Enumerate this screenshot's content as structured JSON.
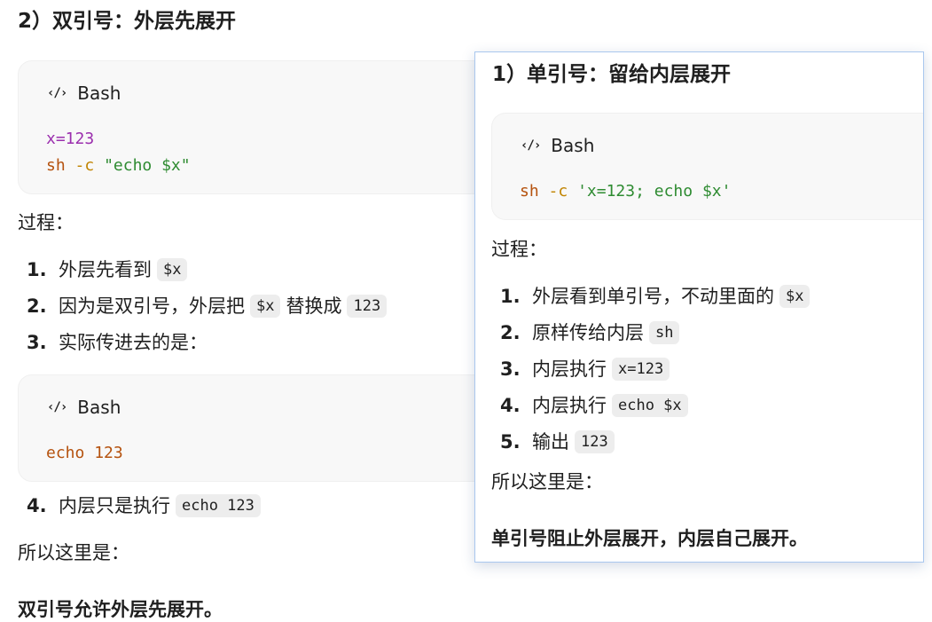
{
  "left": {
    "heading": "2）双引号：外层先展开",
    "code1": {
      "lang": "Bash",
      "line1": {
        "var": "x=123"
      },
      "line2": {
        "cmd": "sh",
        "flag": "-c",
        "str": "\"echo $x\""
      }
    },
    "process_label": "过程：",
    "steps_a": [
      {
        "num": "1.",
        "text": "外层先看到",
        "code": "$x"
      },
      {
        "num": "2.",
        "text": "因为是双引号，外层把",
        "code": "$x",
        "text2": "替换成",
        "code2": "123"
      },
      {
        "num": "3.",
        "text": "实际传进去的是："
      }
    ],
    "code2": {
      "lang": "Bash",
      "line1": {
        "cmd": "echo",
        "arg": "123"
      }
    },
    "steps_b": [
      {
        "num": "4.",
        "text": "内层只是执行",
        "code": "echo 123"
      }
    ],
    "conclusion_label": "所以这里是：",
    "conclusion": "双引号允许外层先展开。"
  },
  "popup": {
    "heading": "1）单引号：留给内层展开",
    "code": {
      "lang": "Bash",
      "line1": {
        "cmd": "sh",
        "flag": "-c",
        "str": "'x=123; echo $x'"
      }
    },
    "process_label": "过程：",
    "steps": [
      {
        "num": "1.",
        "text": "外层看到单引号，不动里面的",
        "code": "$x"
      },
      {
        "num": "2.",
        "text": "原样传给内层",
        "code": "sh"
      },
      {
        "num": "3.",
        "text": "内层执行",
        "code": "x=123"
      },
      {
        "num": "4.",
        "text": "内层执行",
        "code": "echo $x"
      },
      {
        "num": "5.",
        "text": "输出",
        "code": "123"
      }
    ],
    "conclusion_label": "所以这里是：",
    "conclusion": "单引号阻止外层展开，内层自己展开。"
  }
}
